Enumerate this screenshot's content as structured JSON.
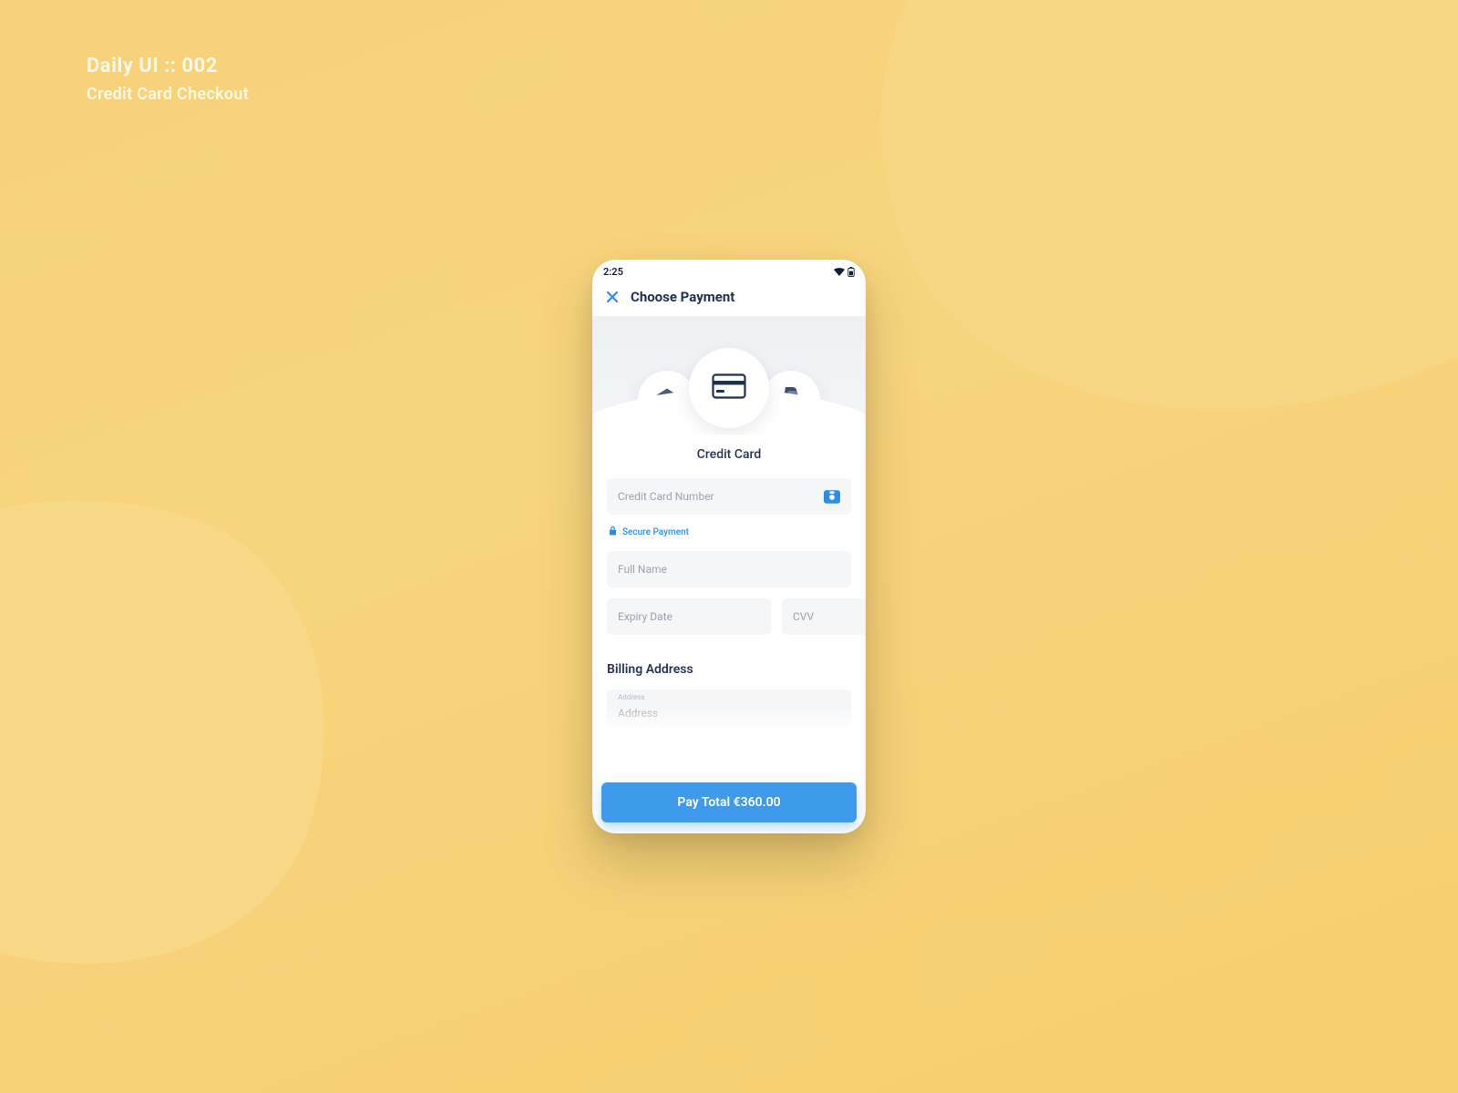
{
  "overlay": {
    "line1": "Daily UI :: 002",
    "line2": "Credit Card Checkout"
  },
  "statusbar": {
    "time": "2:25"
  },
  "header": {
    "title": "Choose Payment"
  },
  "method": {
    "selected_label": "Credit Card"
  },
  "form": {
    "card_number_placeholder": "Credit Card Number",
    "secure_label": "Secure Payment",
    "full_name_placeholder": "Full Name",
    "expiry_placeholder": "Expiry Date",
    "cvv_placeholder": "CVV",
    "billing_title": "Billing Address",
    "address_label": "Address",
    "address_placeholder": "Address"
  },
  "pay": {
    "label": "Pay Total €360.00"
  },
  "colors": {
    "accent": "#3E9AEB",
    "bg": "#F7D278",
    "text_dark": "#20314E"
  }
}
